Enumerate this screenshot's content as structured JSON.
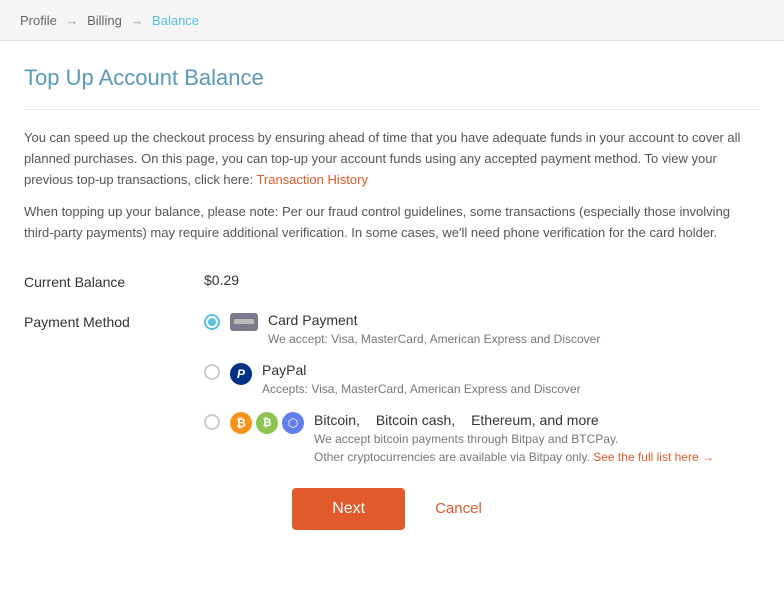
{
  "breadcrumb": {
    "profile": "Profile",
    "billing": "Billing",
    "balance": "Balance",
    "sep1": "→",
    "sep2": "→"
  },
  "page": {
    "title": "Top Up Account Balance"
  },
  "description": {
    "main": "You can speed up the checkout process by ensuring ahead of time that you have adequate funds in your account to cover all planned purchases. On this page, you can top-up your account funds using any accepted payment method. To view your previous top-up transactions, click here:",
    "link": "Transaction History"
  },
  "fraud_note": "When topping up your balance, please note: Per our fraud control guidelines, some transactions (especially those involving third-party payments) may require additional verification. In some cases, we'll need phone verification for the card holder.",
  "current_balance": {
    "label": "Current Balance",
    "value": "$0.29"
  },
  "payment_method": {
    "label": "Payment Method",
    "options": [
      {
        "id": "card",
        "name": "Card Payment",
        "description": "We accept: Visa, MasterCard, American Express and Discover",
        "selected": true
      },
      {
        "id": "paypal",
        "name": "PayPal",
        "description": "Accepts: Visa, MasterCard, American Express and Discover",
        "selected": false
      },
      {
        "id": "crypto",
        "name": "Bitcoin,",
        "name2": "Bitcoin cash,",
        "name3": "Ethereum, and more",
        "description_line1": "We accept bitcoin payments through Bitpay and BTCPay.",
        "description_line2": "Other cryptocurrencies are available via Bitpay only.",
        "link": "See the full list here →",
        "selected": false
      }
    ]
  },
  "buttons": {
    "next": "Next",
    "cancel": "Cancel"
  }
}
